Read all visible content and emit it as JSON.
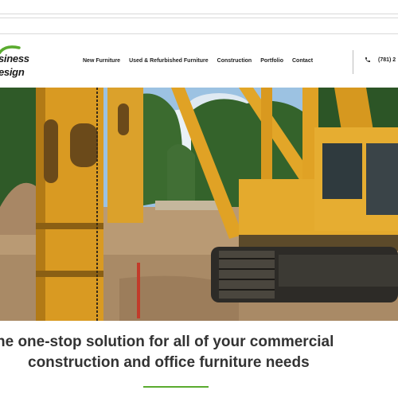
{
  "logo": {
    "line1": "siness",
    "line2": "esign"
  },
  "nav": {
    "items": [
      {
        "label": "New Furniture"
      },
      {
        "label": "Used & Refurbished Furniture"
      },
      {
        "label": "Construction"
      },
      {
        "label": "Portfolio"
      },
      {
        "label": "Contact"
      }
    ]
  },
  "contact": {
    "phone": "(781) 2",
    "icon": "phone-icon"
  },
  "hero": {
    "image": "construction-pile-driver-photo"
  },
  "tagline": {
    "line1": "he one-stop solution for all of your commercial",
    "line2": "construction and office furniture needs"
  },
  "colors": {
    "accent": "#5aab2f",
    "text": "#333333",
    "machine": "#e0a225"
  }
}
